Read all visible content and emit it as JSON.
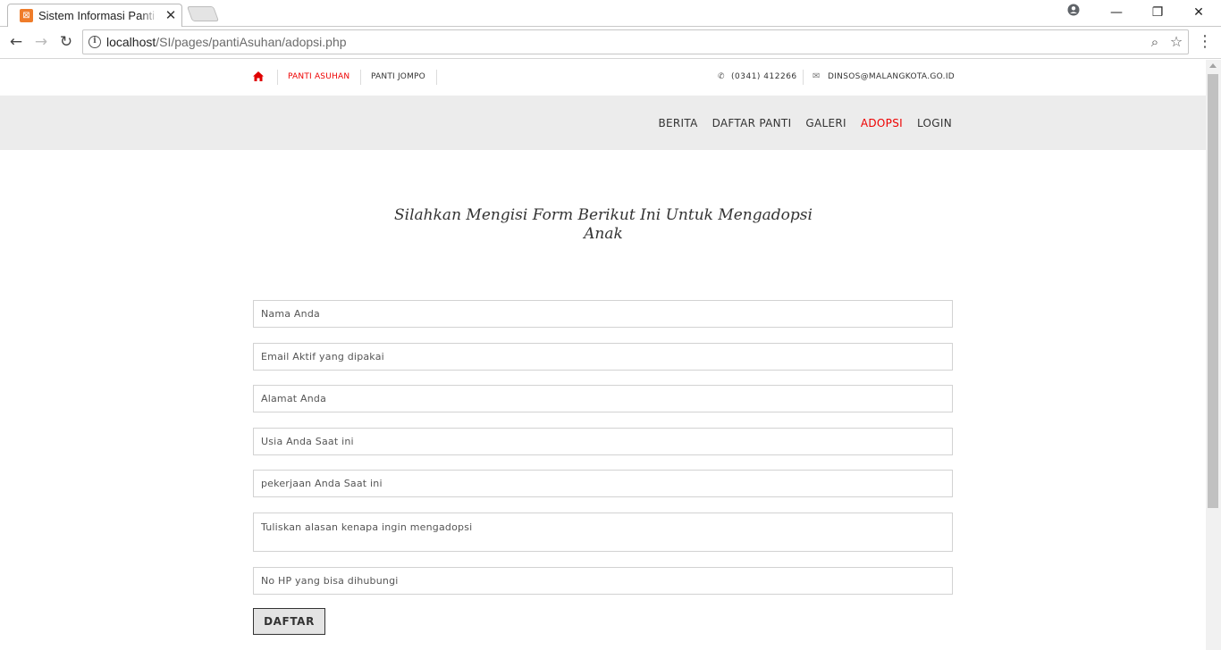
{
  "browser": {
    "tab_title": "Sistem Informasi Panti Asuhan",
    "tab_favicon": "xampp-icon",
    "url_host": "localhost",
    "url_path": "/SI/pages/pantiAsuhan/adopsi.php"
  },
  "topbar": {
    "home_icon": "home-icon",
    "links": [
      "PANTI ASUHAN",
      "PANTI JOMPO"
    ],
    "phone": "(0341) 412266",
    "email": "DINSOS@MALANGKOTA.GO.ID"
  },
  "navbar": {
    "items": [
      "BERITA",
      "DAFTAR PANTI",
      "GALERI",
      "ADOPSI",
      "LOGIN"
    ],
    "active": "ADOPSI"
  },
  "page": {
    "heading_line1": "Silahkan Mengisi Form Berikut Ini Untuk Mengadopsi",
    "heading_line2": "Anak"
  },
  "form": {
    "fields": [
      "Nama Anda",
      "Email Aktif yang dipakai",
      "Alamat Anda",
      "Usia Anda Saat ini",
      "pekerjaan Anda Saat ini",
      "Tuliskan alasan kenapa ingin mengadopsi",
      "No HP yang bisa dihubungi"
    ],
    "submit_label": "DAFTAR"
  },
  "colors": {
    "accent": "#e00000",
    "navbar_bg": "#ececec"
  }
}
